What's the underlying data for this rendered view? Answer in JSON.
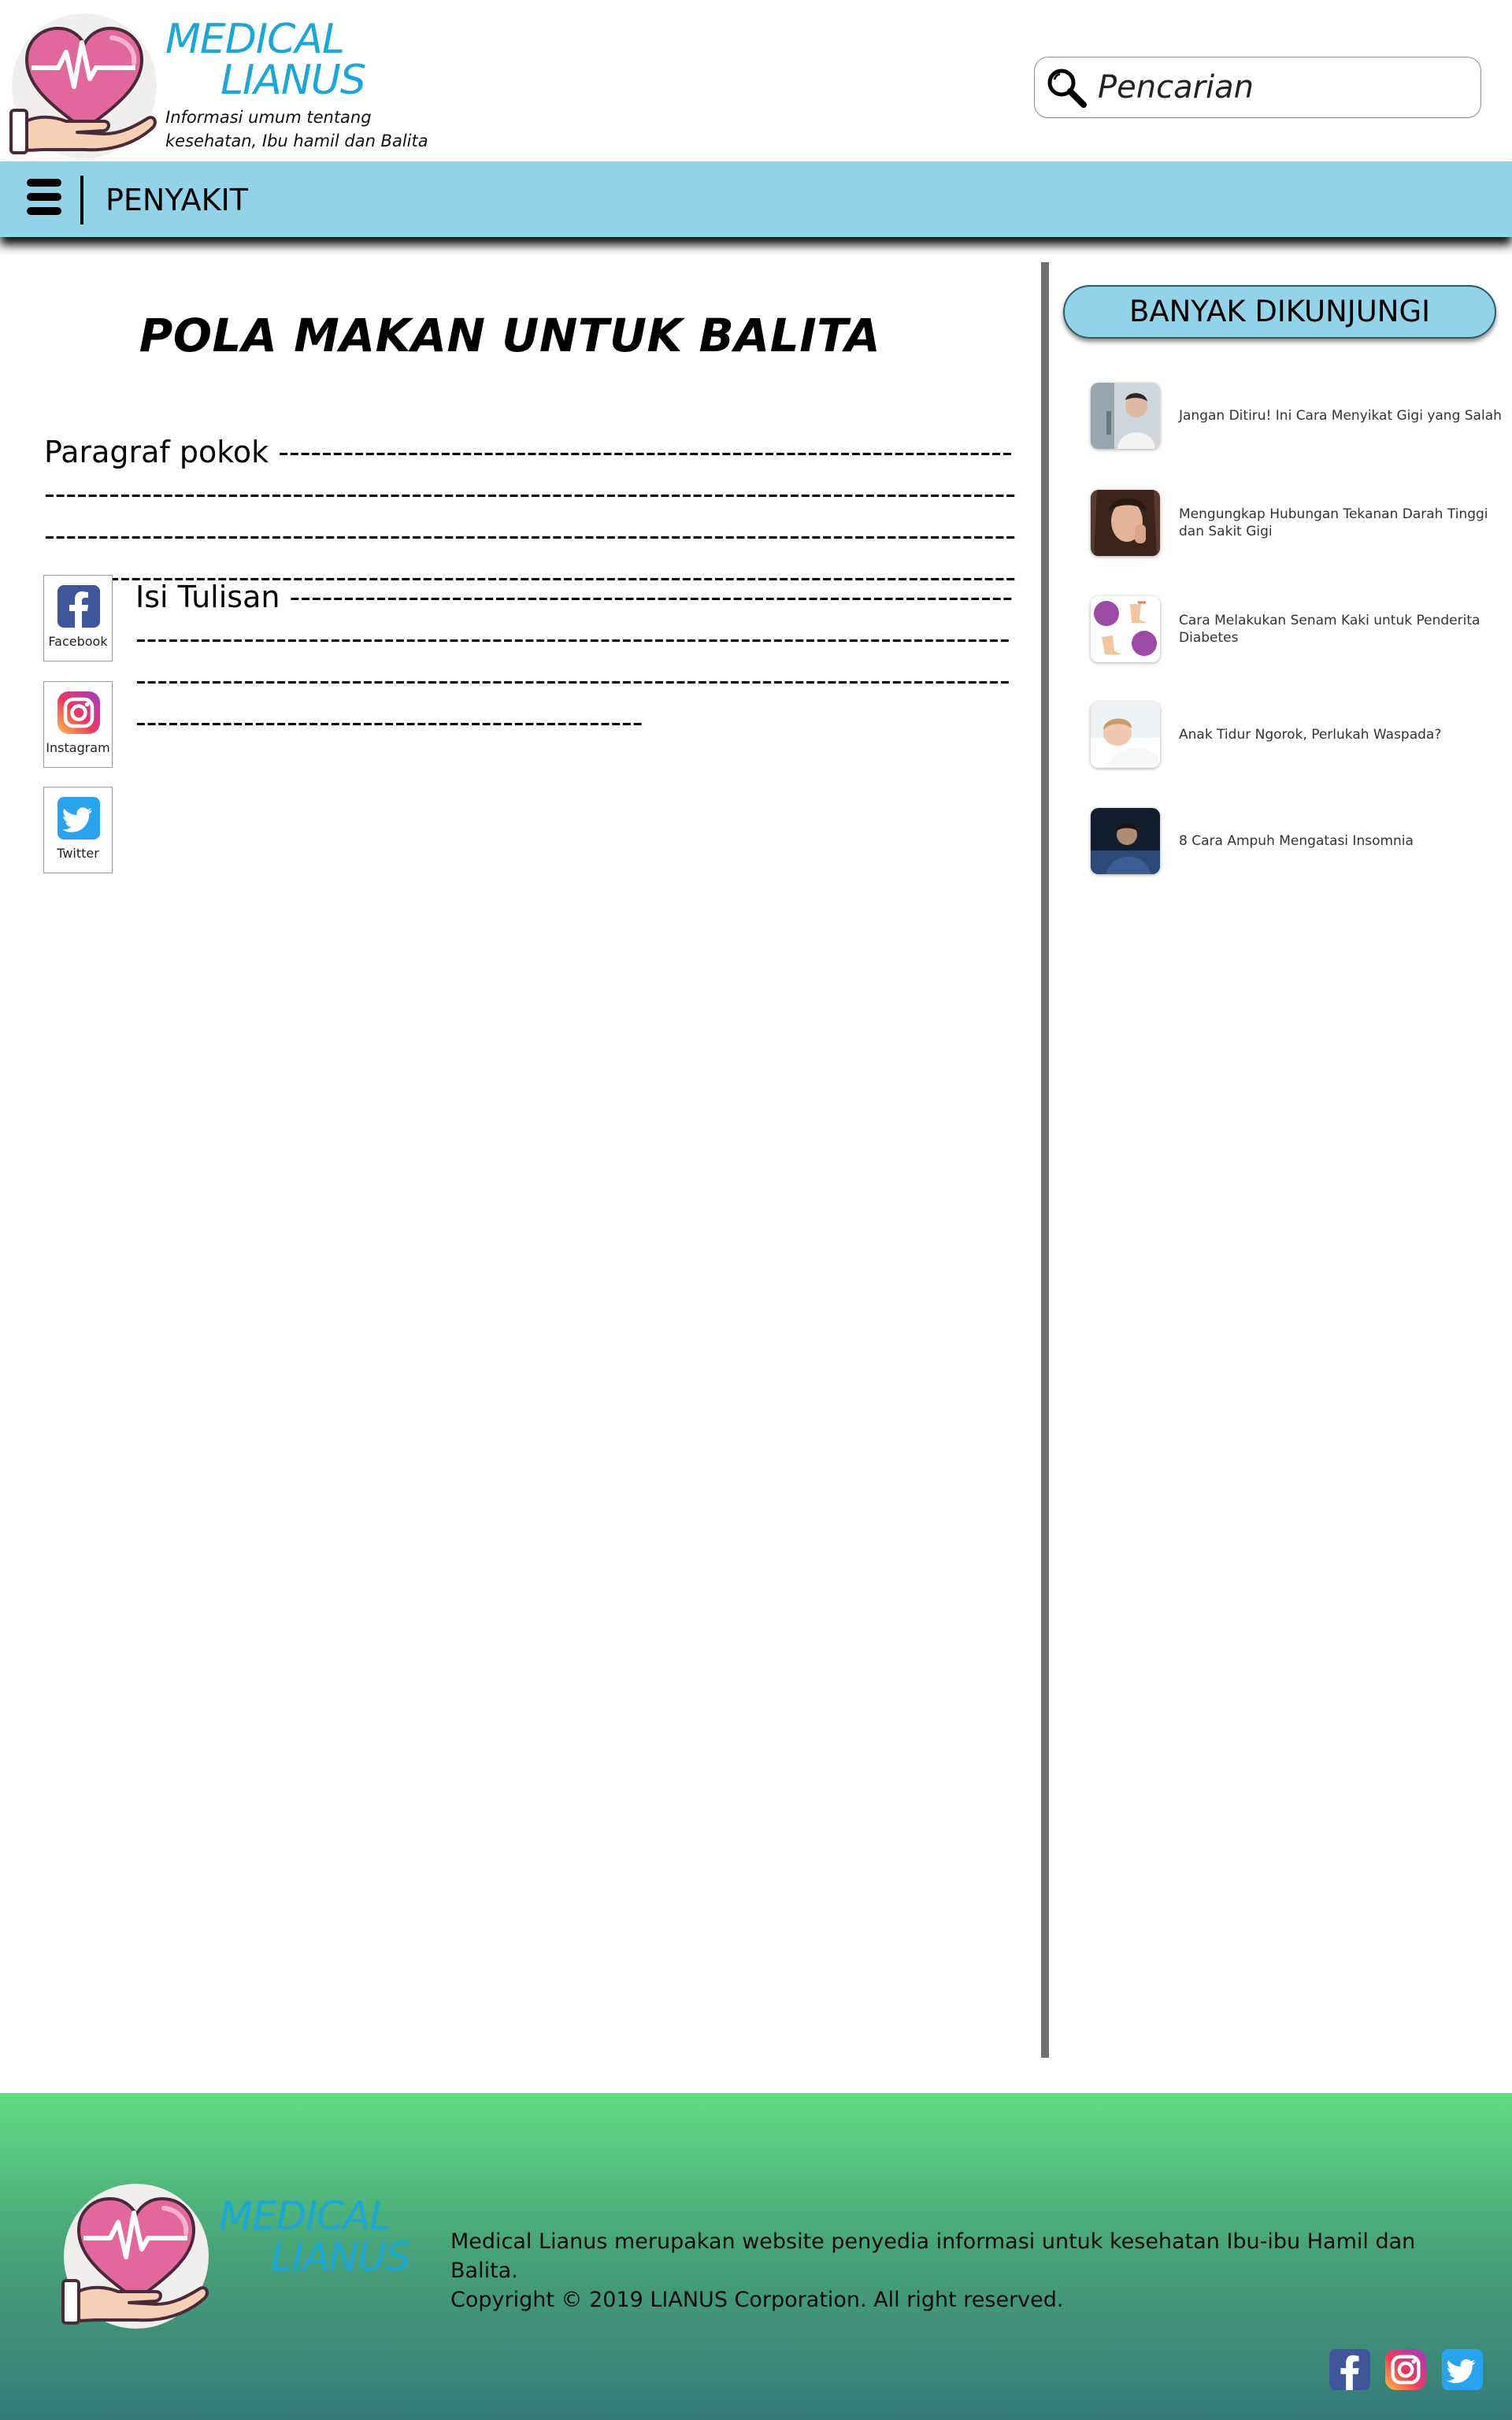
{
  "brand": {
    "title_line1": "MEDICAL",
    "title_line2": "LIANUS",
    "tagline": "Informasi umum tentang kesehatan, Ibu hamil dan Balita"
  },
  "search": {
    "placeholder": "Pencarian",
    "value": ""
  },
  "nav": {
    "label": "PENYAKIT"
  },
  "article": {
    "title": "POLA MAKAN UNTUK BALITA",
    "paragraph_label": "Paragraf pokok",
    "content_label": "Isi Tulisan"
  },
  "share": [
    {
      "label": "Facebook",
      "icon": "facebook-icon"
    },
    {
      "label": "Instagram",
      "icon": "instagram-icon"
    },
    {
      "label": "Twitter",
      "icon": "twitter-icon"
    }
  ],
  "sidebar": {
    "heading": "BANYAK DIKUNJUNGI",
    "items": [
      {
        "title": "Jangan Ditiru! Ini Cara Menyikat Gigi yang Salah"
      },
      {
        "title": "Mengungkap Hubungan Tekanan Darah Tinggi dan Sakit Gigi"
      },
      {
        "title": "Cara Melakukan Senam Kaki untuk Penderita Diabetes"
      },
      {
        "title": "Anak Tidur Ngorok, Perlukah Waspada?"
      },
      {
        "title": "8 Cara Ampuh Mengatasi Insomnia"
      }
    ]
  },
  "footer": {
    "description": "Medical Lianus merupakan website penyedia informasi untuk kesehatan Ibu-ibu Hamil dan Balita.",
    "copyright": "Copyright © 2019 LIANUS Corporation. All right reserved."
  },
  "colors": {
    "accent": "#1ba6d6",
    "navbar": "#92d3ea",
    "heart": "#e1679c",
    "footer_top": "#62dc82",
    "footer_bottom": "#367a78"
  }
}
